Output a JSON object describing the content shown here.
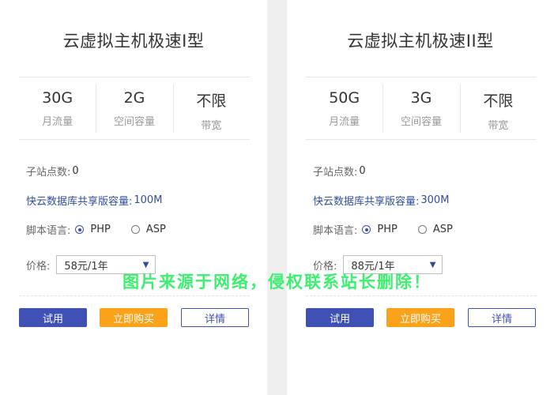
{
  "cards": [
    {
      "title": "云虚拟主机极速I型",
      "specs": [
        {
          "value": "30G",
          "label": "月流量"
        },
        {
          "value": "2G",
          "label": "空间容量"
        },
        {
          "value": "不限",
          "label": "带宽"
        }
      ],
      "sites_label": "子站点数:",
      "sites_value": "0",
      "db_label": "快云数据库共享版容量:",
      "db_value": "100M",
      "lang_label": "脚本语言:",
      "lang_php": "PHP",
      "lang_asp": "ASP",
      "price_label": "价格:",
      "price_value": "58元/1年",
      "btn_try": "试用",
      "btn_buy": "立即购买",
      "btn_detail": "详情"
    },
    {
      "title": "云虚拟主机极速II型",
      "specs": [
        {
          "value": "50G",
          "label": "月流量"
        },
        {
          "value": "3G",
          "label": "空间容量"
        },
        {
          "value": "不限",
          "label": "带宽"
        }
      ],
      "sites_label": "子站点数:",
      "sites_value": "0",
      "db_label": "快云数据库共享版容量:",
      "db_value": "300M",
      "lang_label": "脚本语言:",
      "lang_php": "PHP",
      "lang_asp": "ASP",
      "price_label": "价格:",
      "price_value": "88元/1年",
      "btn_try": "试用",
      "btn_buy": "立即购买",
      "btn_detail": "详情"
    }
  ],
  "selected_language": "PHP",
  "icons": {
    "dropdown": "caret-down-icon",
    "radio_on": "radio-selected-icon",
    "radio_off": "radio-empty-icon"
  },
  "colors": {
    "primary": "#3f51b5",
    "accent": "#f9a21a",
    "watermark": "#3cef6e",
    "db_text": "#2f4f9a"
  },
  "watermark": "图片来源于网络，侵权联系站长删除！"
}
